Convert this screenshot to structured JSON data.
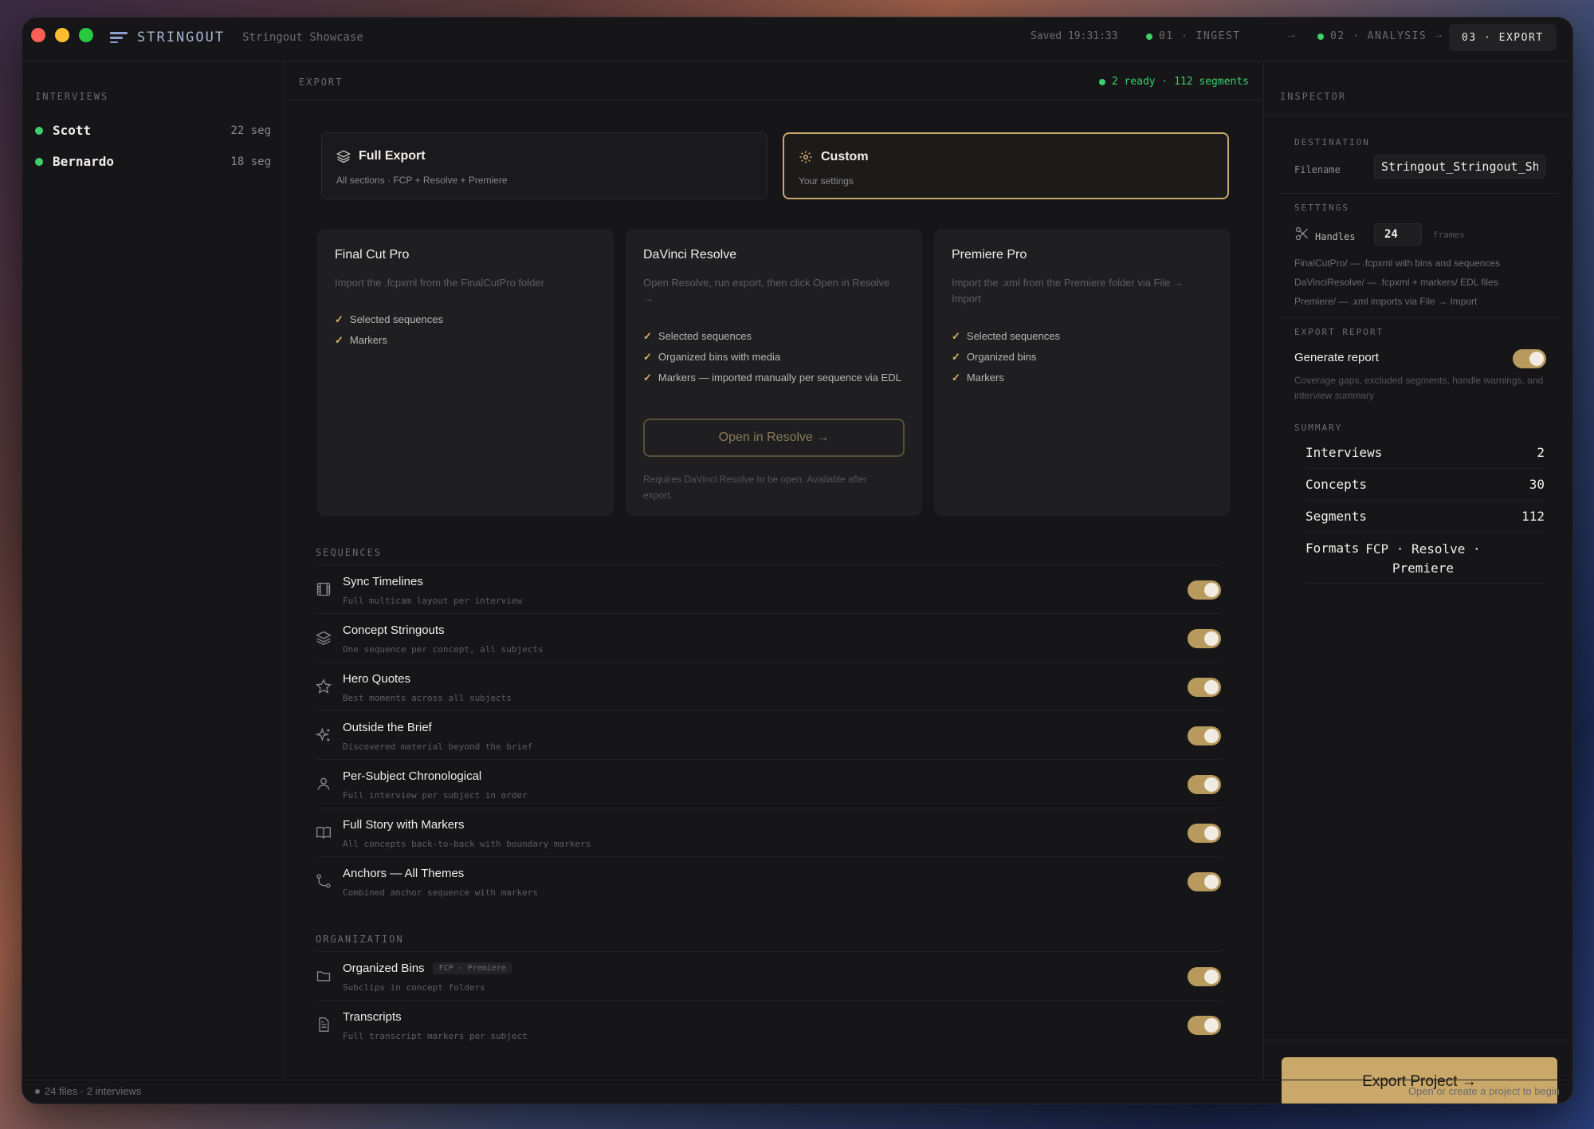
{
  "window": {
    "brand": "STRINGOUT",
    "project": "Stringout Showcase",
    "saved": "Saved 19:31:33"
  },
  "steps": [
    {
      "label": "01 · INGEST",
      "status_color": "#3ecf6a"
    },
    {
      "label": "02 · ANALYSIS",
      "status_color": "#3ecf6a"
    },
    {
      "label": "03 · EXPORT",
      "active": true
    }
  ],
  "step_arrow": "→",
  "sidebar": {
    "label": "INTERVIEWS",
    "items": [
      {
        "name": "Scott",
        "segments": "22 seg"
      },
      {
        "name": "Bernardo",
        "segments": "18 seg"
      }
    ]
  },
  "main": {
    "label": "EXPORT",
    "status": "2 ready · 112 segments",
    "modes": [
      {
        "title": "Full Export",
        "subtitle": "All sections · FCP + Resolve + Premiere",
        "icon": "layers-icon"
      },
      {
        "title": "Custom",
        "subtitle": "Your settings",
        "icon": "gear-icon",
        "selected": true
      }
    ],
    "targets": [
      {
        "title": "Final Cut Pro",
        "desc": "Import the .fcpxml from the FinalCutPro folder",
        "features": [
          "Selected sequences",
          "Markers"
        ]
      },
      {
        "title": "DaVinci Resolve",
        "desc": "Open Resolve, run export, then click Open in Resolve →",
        "features": [
          "Selected sequences",
          "Organized bins with media",
          "Markers — imported manually per sequence via EDL"
        ],
        "button": "Open in Resolve →",
        "note": "Requires DaVinci Resolve to be open. Available after export."
      },
      {
        "title": "Premiere Pro",
        "desc": "Import the .xml from the Premiere folder via File → Import",
        "features": [
          "Selected sequences",
          "Organized bins",
          "Markers"
        ]
      }
    ],
    "sequences_label": "SEQUENCES",
    "sequences": [
      {
        "title": "Sync Timelines",
        "sub": "Full multicam layout per interview",
        "icon": "film-icon",
        "on": true
      },
      {
        "title": "Concept Stringouts",
        "sub": "One sequence per concept, all subjects",
        "icon": "layers-icon",
        "on": true
      },
      {
        "title": "Hero Quotes",
        "sub": "Best moments across all subjects",
        "icon": "star-icon",
        "on": true
      },
      {
        "title": "Outside the Brief",
        "sub": "Discovered material beyond the brief",
        "icon": "sparkles-icon",
        "on": true
      },
      {
        "title": "Per-Subject Chronological",
        "sub": "Full interview per subject in order",
        "icon": "user-icon",
        "on": true
      },
      {
        "title": "Full Story with Markers",
        "sub": "All concepts back-to-back with boundary markers",
        "icon": "book-icon",
        "on": true
      },
      {
        "title": "Anchors — All Themes",
        "sub": "Combined anchor sequence with markers",
        "icon": "branch-icon",
        "on": true
      }
    ],
    "organization_label": "ORGANIZATION",
    "organization": [
      {
        "title": "Organized Bins",
        "badge": "FCP · Premiere",
        "sub": "Subclips in concept folders",
        "icon": "folder-icon",
        "on": true
      },
      {
        "title": "Transcripts",
        "sub": "Full transcript markers per subject",
        "icon": "document-icon",
        "on": true
      }
    ]
  },
  "inspector": {
    "label": "INSPECTOR",
    "destination_label": "DESTINATION",
    "filename_label": "Filename",
    "filename_value": "Stringout_Stringout_Sho",
    "settings_label": "SETTINGS",
    "handles_label": "Handles",
    "handles_value": "24",
    "handles_unit": "frames",
    "paths": [
      "FinalCutPro/ — .fcpxml with bins and sequences",
      "DaVinciResolve/ — .fcpxml + markers/ EDL files",
      "Premiere/ — .xml imports via File → Import"
    ],
    "report_label": "EXPORT REPORT",
    "report_title": "Generate report",
    "report_desc": "Coverage gaps, excluded segments, handle warnings, and interview summary",
    "summary_label": "SUMMARY",
    "summary": [
      {
        "k": "Interviews",
        "v": "2"
      },
      {
        "k": "Concepts",
        "v": "30"
      },
      {
        "k": "Segments",
        "v": "112"
      }
    ],
    "formats_key": "Formats",
    "formats_value": "FCP · Resolve · Premiere",
    "export_button": "Export Project →"
  },
  "statusbar": {
    "left": "24 files · 2 interviews",
    "right": "Open or create a project to begin"
  },
  "colors": {
    "accent": "#c9a86a",
    "ok": "#3ecf6a",
    "bg": "#161618"
  }
}
